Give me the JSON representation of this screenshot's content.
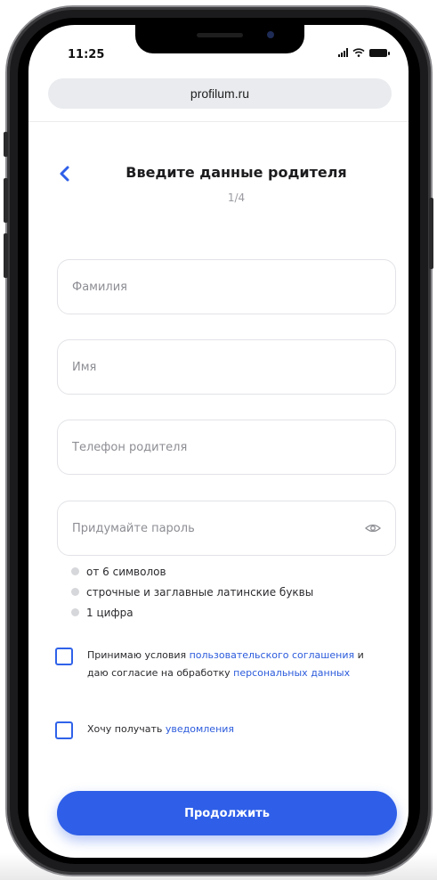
{
  "status": {
    "time": "11:25"
  },
  "browser": {
    "url": "profilum.ru"
  },
  "header": {
    "title": "Введите данные родителя",
    "step": "1/4"
  },
  "form": {
    "surname_placeholder": "Фамилия",
    "name_placeholder": "Имя",
    "phone_placeholder": "Телефон родителя",
    "password_placeholder": "Придумайте пароль"
  },
  "password_hints": [
    "от 6 символов",
    "строчные и заглавные латинские буквы",
    "1 цифра"
  ],
  "agreement": {
    "text_1": "Принимаю условия ",
    "link_1": "пользовательского соглашения",
    "text_2": " и даю согласие на обработку ",
    "link_2": "персональных данных",
    "checked": false
  },
  "notifications": {
    "text": "Хочу получать ",
    "link": "уведомления",
    "checked": false
  },
  "continue_label": "Продолжить",
  "colors": {
    "accent": "#2f5fe8",
    "link": "#2b5bdc",
    "frame": "#1b1b1d"
  }
}
